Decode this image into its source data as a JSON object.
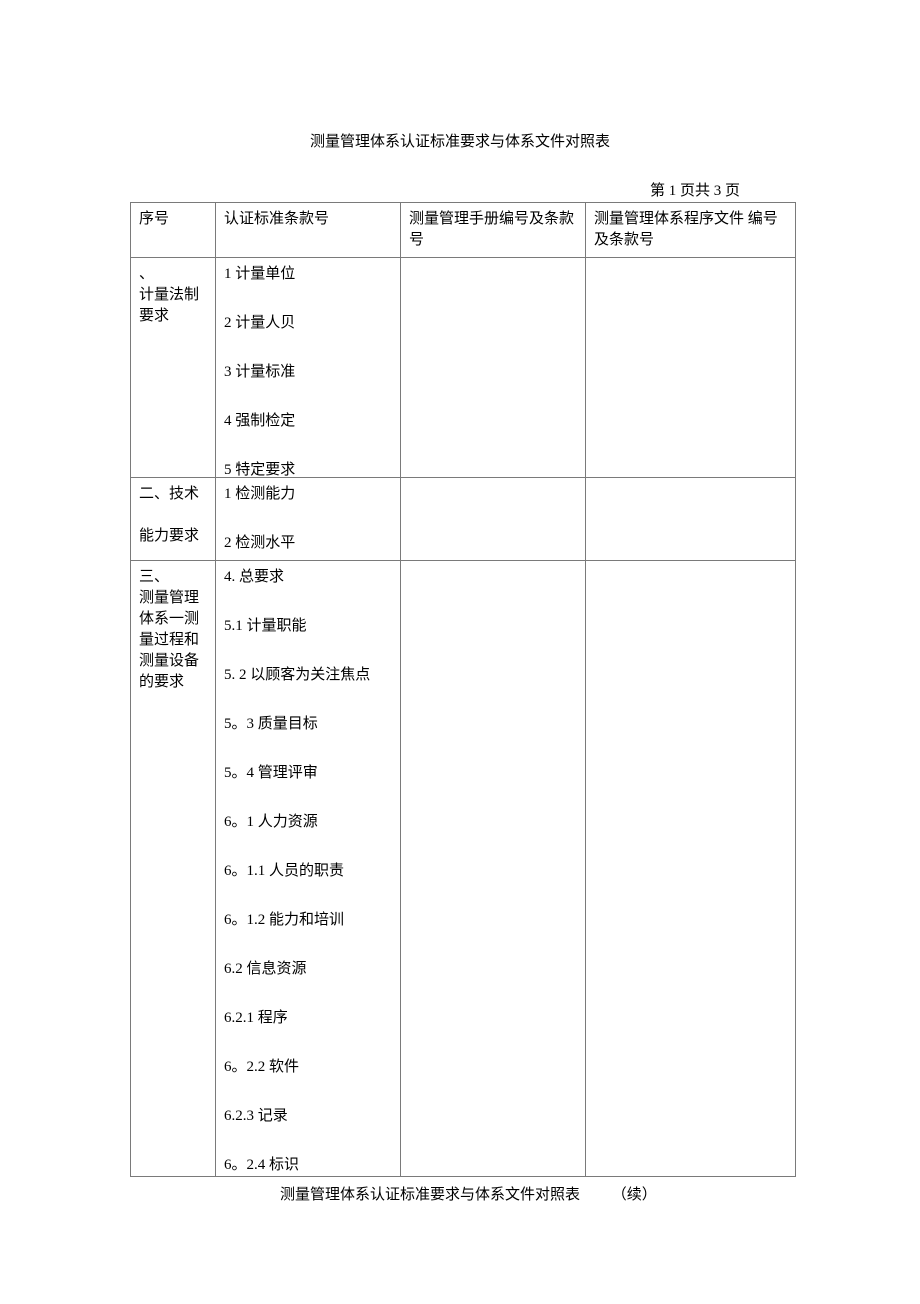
{
  "title": "测量管理体系认证标准要求与体系文件对照表",
  "page_info": "第 1 页共 3 页",
  "headers": {
    "seq": "序号",
    "clause": "认证标准条款号",
    "manual": "测量管理手册编号及条款号",
    "procedure": "测量管理体系程序文件 编号及条款号"
  },
  "rows": [
    {
      "seq": "、\n计量法制 要求",
      "items": [
        "1 计量单位",
        "2 计量人贝",
        "3 计量标准",
        "4 强制检定",
        "5 特定要求"
      ]
    },
    {
      "seq": "二、技术\n\n能力要求",
      "items": [
        "1 检测能力",
        "2 检测水平"
      ]
    },
    {
      "seq": "三、\n测量管理 体系一测 量过程和 测量设备 的要求",
      "items": [
        "4. 总要求",
        "5.1    计量职能",
        "5.  2 以顾客为关注焦点",
        "5。3 质量目标",
        "5。4 管理评审",
        "6。1 人力资源",
        "6。1.1 人员的职责",
        "6。1.2 能力和培训",
        "6.2 信息资源",
        "6.2.1 程序",
        "6。2.2 软件",
        "6.2.3 记录",
        "6。2.4 标识"
      ]
    }
  ],
  "footer_title": "测量管理体系认证标准要求与体系文件对照表",
  "footer_cont": "（续）"
}
